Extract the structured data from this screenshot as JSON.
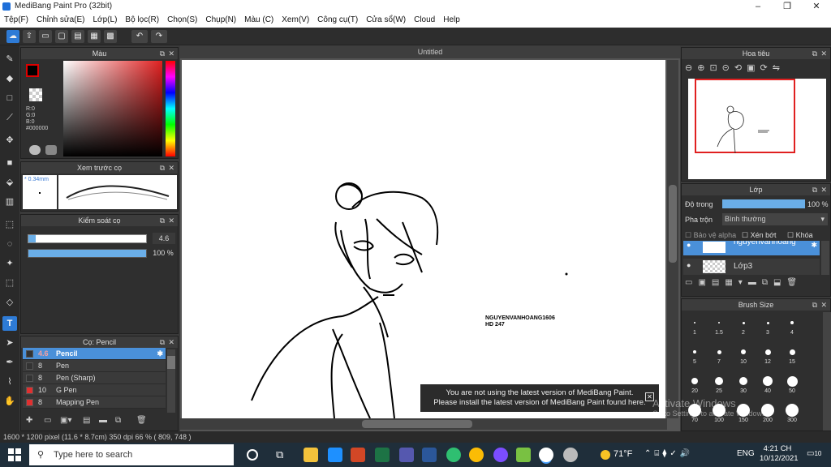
{
  "window": {
    "title": "MediBang Paint Pro (32bit)",
    "minimize": "–",
    "maximize": "❐",
    "close": "✕"
  },
  "menu": [
    "Tệp(F)",
    "Chỉnh sửa(E)",
    "Lớp(L)",
    "Bộ lọc(R)",
    "Chọn(S)",
    "Chụp(N)",
    "Màu (C)",
    "Xem(V)",
    "Công cụ(T)",
    "Cửa sổ(W)",
    "Cloud",
    "Help"
  ],
  "color_panel": {
    "title": "Màu",
    "r": "R:0",
    "g": "G:0",
    "b": "B:0",
    "hex": "#000000"
  },
  "brush_preview": {
    "title": "Xem trước cọ",
    "size": "* 0.34mm"
  },
  "brush_control": {
    "title": "Kiểm soát cọ",
    "size_value": "4.6",
    "opacity_value": "100 %",
    "size_fraction": 0.06,
    "opacity_fraction": 1.0
  },
  "brush_list": {
    "title": "Cọ: Pencil",
    "items": [
      {
        "size": "4.6",
        "name": "Pencil",
        "color": "#333333",
        "selected": true
      },
      {
        "size": "8",
        "name": "Pen",
        "color": "#333333",
        "selected": false
      },
      {
        "size": "8",
        "name": "Pen (Sharp)",
        "color": "#333333",
        "selected": false
      },
      {
        "size": "10",
        "name": "G Pen",
        "color": "#e03030",
        "selected": false
      },
      {
        "size": "8",
        "name": "Mapping Pen",
        "color": "#e03030",
        "selected": false
      }
    ]
  },
  "canvas": {
    "tab_title": "Untitled",
    "text_line1": "NGUYENVANHOANG1606",
    "text_line2": "HD 247"
  },
  "notice": {
    "line1": "You are not using the latest version of MediBang Paint.",
    "line2": "Please install the latest version of MediBang Paint found here.",
    "close": "✕"
  },
  "navigator": {
    "title": "Hoa tiêu"
  },
  "layers": {
    "title": "Lớp",
    "opacity_label": "Độ trong",
    "opacity_value": "100 %",
    "opacity_fraction": 1.0,
    "blend_label": "Pha trộn",
    "blend_value": "Bình thường",
    "protect_alpha": "Bảo vệ alpha",
    "clipping": "Xén bớt",
    "lock": "Khóa",
    "items": [
      {
        "name": "nguyenvanhoang"
      },
      {
        "name": "Lớp3"
      }
    ]
  },
  "brush_size": {
    "title": "Brush Size",
    "sizes": [
      "1",
      "1.5",
      "2",
      "3",
      "4",
      "5",
      "7",
      "10",
      "12",
      "15",
      "20",
      "25",
      "30",
      "40",
      "50",
      "70",
      "100",
      "150",
      "200",
      "300"
    ]
  },
  "watermark": {
    "line1": "Activate Windows",
    "line2": "Go to Settings to activate Windows."
  },
  "status": {
    "text": "1600 * 1200 pixel   (11.6 * 8.7cm)   350 dpi   66 %   ( 809, 748 )"
  },
  "taskbar": {
    "search_placeholder": "Type here to search",
    "weather": "71°F",
    "lang": "ENG",
    "time": "4:21 CH",
    "date": "10/12/2021",
    "notifications": "10"
  }
}
